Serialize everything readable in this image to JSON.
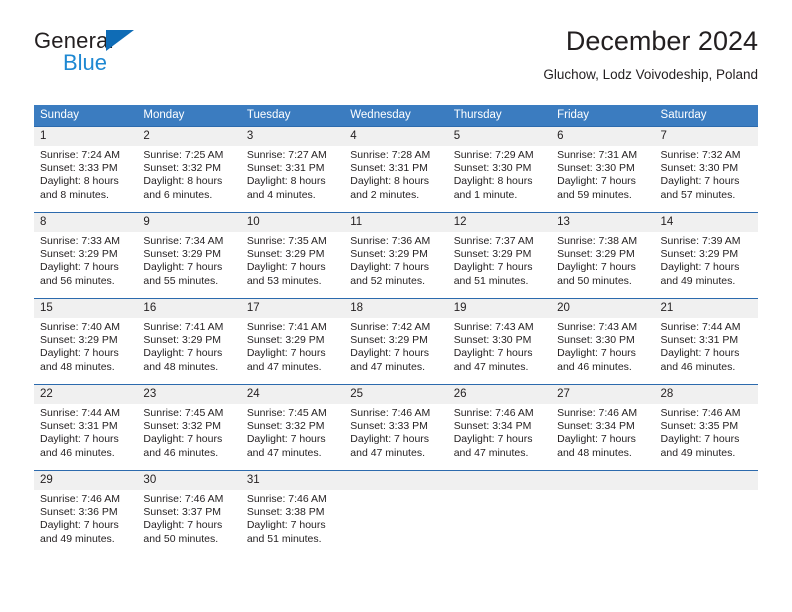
{
  "brand": {
    "name_top": "General",
    "name_bottom": "Blue",
    "accent_color": "#1e88d2",
    "triangle_color": "#0f6cb6"
  },
  "header": {
    "title": "December 2024",
    "location": "Gluchow, Lodz Voivodeship, Poland"
  },
  "theme": {
    "header_row_bg": "#3b7cc0",
    "header_row_text": "#ffffff",
    "row_border": "#2c6aad",
    "daynum_bg": "#f0f0f0",
    "text": "#231f20"
  },
  "calendar": {
    "weekday_headers": [
      "Sunday",
      "Monday",
      "Tuesday",
      "Wednesday",
      "Thursday",
      "Friday",
      "Saturday"
    ],
    "labels": {
      "sunrise": "Sunrise:",
      "sunset": "Sunset:",
      "daylight": "Daylight:"
    },
    "weeks": [
      [
        {
          "day": "1",
          "sunrise": "Sunrise: 7:24 AM",
          "sunset": "Sunset: 3:33 PM",
          "daylight_1": "Daylight: 8 hours",
          "daylight_2": "and 8 minutes."
        },
        {
          "day": "2",
          "sunrise": "Sunrise: 7:25 AM",
          "sunset": "Sunset: 3:32 PM",
          "daylight_1": "Daylight: 8 hours",
          "daylight_2": "and 6 minutes."
        },
        {
          "day": "3",
          "sunrise": "Sunrise: 7:27 AM",
          "sunset": "Sunset: 3:31 PM",
          "daylight_1": "Daylight: 8 hours",
          "daylight_2": "and 4 minutes."
        },
        {
          "day": "4",
          "sunrise": "Sunrise: 7:28 AM",
          "sunset": "Sunset: 3:31 PM",
          "daylight_1": "Daylight: 8 hours",
          "daylight_2": "and 2 minutes."
        },
        {
          "day": "5",
          "sunrise": "Sunrise: 7:29 AM",
          "sunset": "Sunset: 3:30 PM",
          "daylight_1": "Daylight: 8 hours",
          "daylight_2": "and 1 minute."
        },
        {
          "day": "6",
          "sunrise": "Sunrise: 7:31 AM",
          "sunset": "Sunset: 3:30 PM",
          "daylight_1": "Daylight: 7 hours",
          "daylight_2": "and 59 minutes."
        },
        {
          "day": "7",
          "sunrise": "Sunrise: 7:32 AM",
          "sunset": "Sunset: 3:30 PM",
          "daylight_1": "Daylight: 7 hours",
          "daylight_2": "and 57 minutes."
        }
      ],
      [
        {
          "day": "8",
          "sunrise": "Sunrise: 7:33 AM",
          "sunset": "Sunset: 3:29 PM",
          "daylight_1": "Daylight: 7 hours",
          "daylight_2": "and 56 minutes."
        },
        {
          "day": "9",
          "sunrise": "Sunrise: 7:34 AM",
          "sunset": "Sunset: 3:29 PM",
          "daylight_1": "Daylight: 7 hours",
          "daylight_2": "and 55 minutes."
        },
        {
          "day": "10",
          "sunrise": "Sunrise: 7:35 AM",
          "sunset": "Sunset: 3:29 PM",
          "daylight_1": "Daylight: 7 hours",
          "daylight_2": "and 53 minutes."
        },
        {
          "day": "11",
          "sunrise": "Sunrise: 7:36 AM",
          "sunset": "Sunset: 3:29 PM",
          "daylight_1": "Daylight: 7 hours",
          "daylight_2": "and 52 minutes."
        },
        {
          "day": "12",
          "sunrise": "Sunrise: 7:37 AM",
          "sunset": "Sunset: 3:29 PM",
          "daylight_1": "Daylight: 7 hours",
          "daylight_2": "and 51 minutes."
        },
        {
          "day": "13",
          "sunrise": "Sunrise: 7:38 AM",
          "sunset": "Sunset: 3:29 PM",
          "daylight_1": "Daylight: 7 hours",
          "daylight_2": "and 50 minutes."
        },
        {
          "day": "14",
          "sunrise": "Sunrise: 7:39 AM",
          "sunset": "Sunset: 3:29 PM",
          "daylight_1": "Daylight: 7 hours",
          "daylight_2": "and 49 minutes."
        }
      ],
      [
        {
          "day": "15",
          "sunrise": "Sunrise: 7:40 AM",
          "sunset": "Sunset: 3:29 PM",
          "daylight_1": "Daylight: 7 hours",
          "daylight_2": "and 48 minutes."
        },
        {
          "day": "16",
          "sunrise": "Sunrise: 7:41 AM",
          "sunset": "Sunset: 3:29 PM",
          "daylight_1": "Daylight: 7 hours",
          "daylight_2": "and 48 minutes."
        },
        {
          "day": "17",
          "sunrise": "Sunrise: 7:41 AM",
          "sunset": "Sunset: 3:29 PM",
          "daylight_1": "Daylight: 7 hours",
          "daylight_2": "and 47 minutes."
        },
        {
          "day": "18",
          "sunrise": "Sunrise: 7:42 AM",
          "sunset": "Sunset: 3:29 PM",
          "daylight_1": "Daylight: 7 hours",
          "daylight_2": "and 47 minutes."
        },
        {
          "day": "19",
          "sunrise": "Sunrise: 7:43 AM",
          "sunset": "Sunset: 3:30 PM",
          "daylight_1": "Daylight: 7 hours",
          "daylight_2": "and 47 minutes."
        },
        {
          "day": "20",
          "sunrise": "Sunrise: 7:43 AM",
          "sunset": "Sunset: 3:30 PM",
          "daylight_1": "Daylight: 7 hours",
          "daylight_2": "and 46 minutes."
        },
        {
          "day": "21",
          "sunrise": "Sunrise: 7:44 AM",
          "sunset": "Sunset: 3:31 PM",
          "daylight_1": "Daylight: 7 hours",
          "daylight_2": "and 46 minutes."
        }
      ],
      [
        {
          "day": "22",
          "sunrise": "Sunrise: 7:44 AM",
          "sunset": "Sunset: 3:31 PM",
          "daylight_1": "Daylight: 7 hours",
          "daylight_2": "and 46 minutes."
        },
        {
          "day": "23",
          "sunrise": "Sunrise: 7:45 AM",
          "sunset": "Sunset: 3:32 PM",
          "daylight_1": "Daylight: 7 hours",
          "daylight_2": "and 46 minutes."
        },
        {
          "day": "24",
          "sunrise": "Sunrise: 7:45 AM",
          "sunset": "Sunset: 3:32 PM",
          "daylight_1": "Daylight: 7 hours",
          "daylight_2": "and 47 minutes."
        },
        {
          "day": "25",
          "sunrise": "Sunrise: 7:46 AM",
          "sunset": "Sunset: 3:33 PM",
          "daylight_1": "Daylight: 7 hours",
          "daylight_2": "and 47 minutes."
        },
        {
          "day": "26",
          "sunrise": "Sunrise: 7:46 AM",
          "sunset": "Sunset: 3:34 PM",
          "daylight_1": "Daylight: 7 hours",
          "daylight_2": "and 47 minutes."
        },
        {
          "day": "27",
          "sunrise": "Sunrise: 7:46 AM",
          "sunset": "Sunset: 3:34 PM",
          "daylight_1": "Daylight: 7 hours",
          "daylight_2": "and 48 minutes."
        },
        {
          "day": "28",
          "sunrise": "Sunrise: 7:46 AM",
          "sunset": "Sunset: 3:35 PM",
          "daylight_1": "Daylight: 7 hours",
          "daylight_2": "and 49 minutes."
        }
      ],
      [
        {
          "day": "29",
          "sunrise": "Sunrise: 7:46 AM",
          "sunset": "Sunset: 3:36 PM",
          "daylight_1": "Daylight: 7 hours",
          "daylight_2": "and 49 minutes."
        },
        {
          "day": "30",
          "sunrise": "Sunrise: 7:46 AM",
          "sunset": "Sunset: 3:37 PM",
          "daylight_1": "Daylight: 7 hours",
          "daylight_2": "and 50 minutes."
        },
        {
          "day": "31",
          "sunrise": "Sunrise: 7:46 AM",
          "sunset": "Sunset: 3:38 PM",
          "daylight_1": "Daylight: 7 hours",
          "daylight_2": "and 51 minutes."
        },
        {
          "day": "",
          "sunrise": "",
          "sunset": "",
          "daylight_1": "",
          "daylight_2": ""
        },
        {
          "day": "",
          "sunrise": "",
          "sunset": "",
          "daylight_1": "",
          "daylight_2": ""
        },
        {
          "day": "",
          "sunrise": "",
          "sunset": "",
          "daylight_1": "",
          "daylight_2": ""
        },
        {
          "day": "",
          "sunrise": "",
          "sunset": "",
          "daylight_1": "",
          "daylight_2": ""
        }
      ]
    ]
  }
}
